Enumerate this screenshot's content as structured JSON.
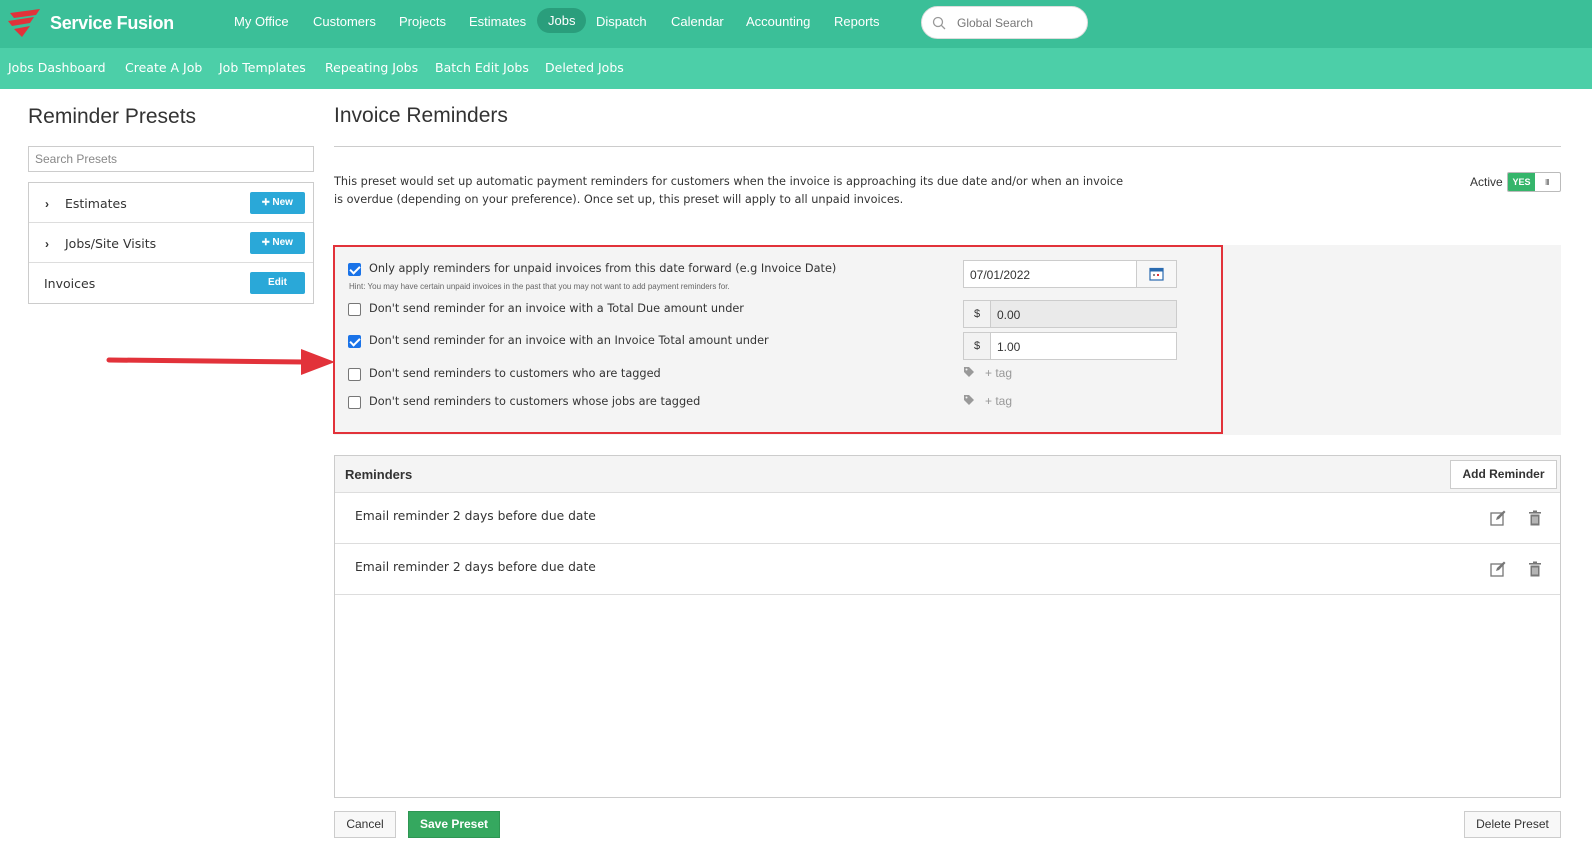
{
  "brand": {
    "name": "Service Fusion",
    "color": "#3bbf98",
    "sub_color": "#4ccfa8"
  },
  "nav": {
    "items": [
      "My Office",
      "Customers",
      "Projects",
      "Estimates",
      "Jobs",
      "Dispatch",
      "Calendar",
      "Accounting",
      "Reports"
    ],
    "active": "Jobs"
  },
  "search": {
    "placeholder": "Global Search"
  },
  "subnav": {
    "items": [
      "Jobs Dashboard",
      "Create A Job",
      "Job Templates",
      "Repeating Jobs",
      "Batch Edit Jobs",
      "Deleted Jobs"
    ]
  },
  "left": {
    "title": "Reminder Presets",
    "search_placeholder": "Search Presets",
    "presets": [
      {
        "label": "Estimates",
        "button": "New",
        "expandable": true
      },
      {
        "label": "Jobs/Site Visits",
        "button": "New",
        "expandable": true
      },
      {
        "label": "Invoices",
        "button": "Edit",
        "expandable": false
      }
    ]
  },
  "main": {
    "title": "Invoice Reminders",
    "description": "This preset would set up automatic payment reminders for customers when the invoice is approaching its due date and/or when an invoice is overdue (depending on your preference). Once set up, this preset will apply to all unpaid invoices.",
    "active_label": "Active",
    "active_toggle": "YES",
    "active_toggle_grip": "III",
    "options": [
      {
        "label": "Only apply reminders for unpaid invoices from this date forward (e.g Invoice Date)",
        "checked": true
      },
      {
        "label": "Don't send reminder for an invoice with a Total Due amount under",
        "checked": false
      },
      {
        "label": "Don't send reminder for an invoice with an Invoice Total amount under",
        "checked": true
      },
      {
        "label": "Don't send reminders to customers who are tagged",
        "checked": false
      },
      {
        "label": "Don't send reminders to customers whose jobs are tagged",
        "checked": false
      }
    ],
    "hint": "Hint: You may have certain unpaid invoices in the past that you may not want to add payment reminders for.",
    "date_value": "07/01/2022",
    "currency_symbol": "$",
    "total_due_value": "0.00",
    "invoice_total_value": "1.00",
    "tag_placeholder": "+ tag"
  },
  "reminders": {
    "title": "Reminders",
    "add_label": "Add Reminder",
    "items": [
      "Email reminder 2 days before due date",
      "Email reminder 2 days before due date"
    ]
  },
  "footer": {
    "cancel": "Cancel",
    "save": "Save Preset",
    "delete": "Delete Preset"
  },
  "annotation": {
    "highlight_color": "#e2323a",
    "arrow_color": "#e2323a"
  }
}
